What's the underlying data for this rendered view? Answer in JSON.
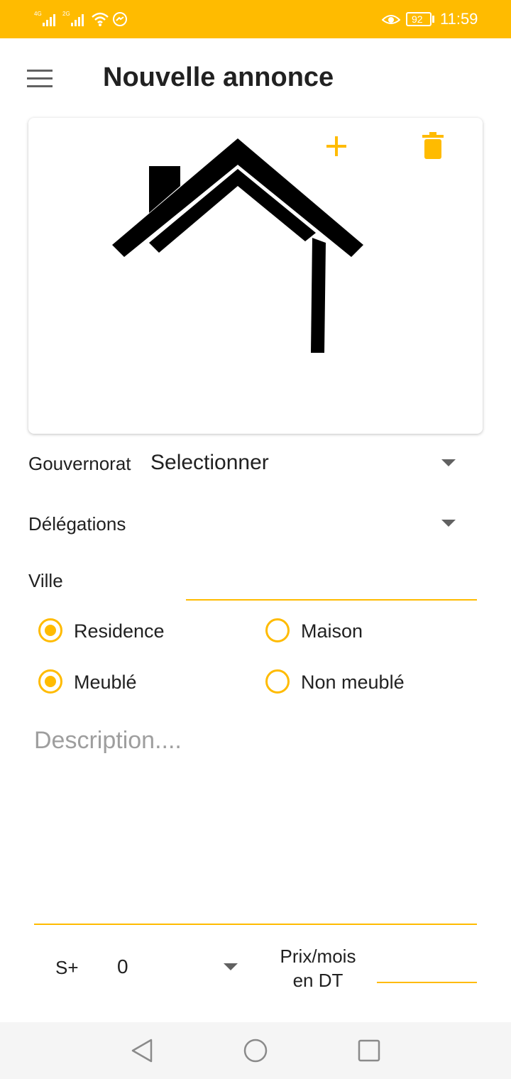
{
  "status_bar": {
    "network_1": "4G",
    "network_2": "2G",
    "battery": "92",
    "time": "11:59",
    "icons": [
      "signal-icon",
      "signal-icon",
      "wifi-icon",
      "messenger-icon",
      "eye-icon",
      "battery-icon"
    ]
  },
  "header": {
    "title": "Nouvelle annonce",
    "menu_icon": "menu-icon"
  },
  "photo_card": {
    "add_icon": "plus-icon",
    "delete_icon": "trash-icon",
    "image": "house-icon"
  },
  "form": {
    "gouvernorat_label": "Gouvernorat",
    "gouvernorat_value": "Selectionner",
    "delegations_label": "Délégations",
    "ville_label": "Ville",
    "ville_value": "",
    "type_options": [
      {
        "label": "Residence",
        "selected": true
      },
      {
        "label": "Maison",
        "selected": false
      }
    ],
    "furnish_options": [
      {
        "label": "Meublé",
        "selected": true
      },
      {
        "label": "Non meublé",
        "selected": false
      }
    ],
    "description_placeholder": "Description....",
    "rooms_label": "S+",
    "rooms_value": "0",
    "price_label_line1": "Prix/mois",
    "price_label_line2": "en DT",
    "price_value": ""
  },
  "nav_bar": {
    "back_icon": "back-icon",
    "home_icon": "home-icon",
    "recents_icon": "recents-icon"
  },
  "colors": {
    "accent": "#FFBB00",
    "text": "#212121",
    "placeholder": "#9e9e9e"
  }
}
